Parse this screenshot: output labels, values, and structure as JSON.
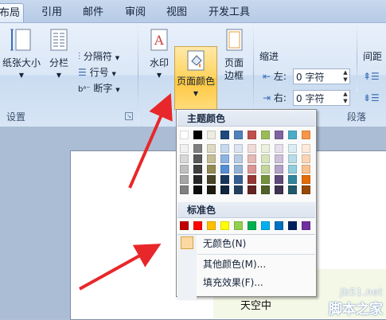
{
  "tabs": [
    "布局",
    "引用",
    "邮件",
    "审阅",
    "视图",
    "开发工具"
  ],
  "ribbon": {
    "page_setup": {
      "paper_size": "纸张大小",
      "columns": "分栏",
      "breaks": "分隔符",
      "line_numbers": "行号",
      "hyphenation": "断字",
      "group_label": "设置"
    },
    "page_background": {
      "watermark": "水印",
      "page_color": "页面颜色",
      "page_border_1": "页面",
      "page_border_2": "边框"
    },
    "paragraph": {
      "indent_title": "缩进",
      "spacing_title": "间距",
      "left_label": "左:",
      "right_label": "右:",
      "left_value": "0 字符",
      "right_value": "0 字符",
      "group_label": "段落"
    }
  },
  "menu": {
    "theme_colors_title": "主题颜色",
    "standard_colors_title": "标准色",
    "no_color": "无颜色(N)",
    "more_colors": "其他颜色(M)...",
    "fill_effects": "填充效果(F)...",
    "theme_columns": [
      [
        "#ffffff",
        "#f2f2f2",
        "#d8d8d8",
        "#bfbfbf",
        "#a5a5a5",
        "#7f7f7f"
      ],
      [
        "#000000",
        "#7f7f7f",
        "#595959",
        "#3f3f3f",
        "#262626",
        "#0c0c0c"
      ],
      [
        "#eeece1",
        "#ddd9c3",
        "#c4bd97",
        "#938953",
        "#494429",
        "#1d1b10"
      ],
      [
        "#1f497d",
        "#c6d9f0",
        "#8db3e2",
        "#548dd4",
        "#17365d",
        "#0f243e"
      ],
      [
        "#4f81bd",
        "#dbe5f1",
        "#b8cce4",
        "#95b3d7",
        "#366092",
        "#244061"
      ],
      [
        "#c0504d",
        "#f2dcdb",
        "#e5b9b7",
        "#d99694",
        "#953734",
        "#632423"
      ],
      [
        "#9bbb59",
        "#ebf1dd",
        "#d7e3bc",
        "#c3d69b",
        "#76923c",
        "#4f6128"
      ],
      [
        "#8064a2",
        "#e5e0ec",
        "#ccc1d9",
        "#b2a2c7",
        "#5f497a",
        "#3f3151"
      ],
      [
        "#4bacc6",
        "#dbeef3",
        "#b7dde8",
        "#92cddc",
        "#31859b",
        "#205867"
      ],
      [
        "#f79646",
        "#fdeada",
        "#fbd5b5",
        "#fac08f",
        "#e36c09",
        "#974806"
      ]
    ],
    "standard_colors": [
      "#c00000",
      "#ff0000",
      "#ffc000",
      "#ffff00",
      "#92d050",
      "#00b050",
      "#00b0f0",
      "#0070c0",
      "#002060",
      "#7030a0"
    ],
    "no_color_swatch": "#fbd9a0"
  },
  "document": {
    "text": "天空中"
  },
  "watermark_site": {
    "url": "jb51.net",
    "name": "脚本之家"
  },
  "colors": {
    "arrow": "#e8272a",
    "highlight": "#ffd35e"
  }
}
